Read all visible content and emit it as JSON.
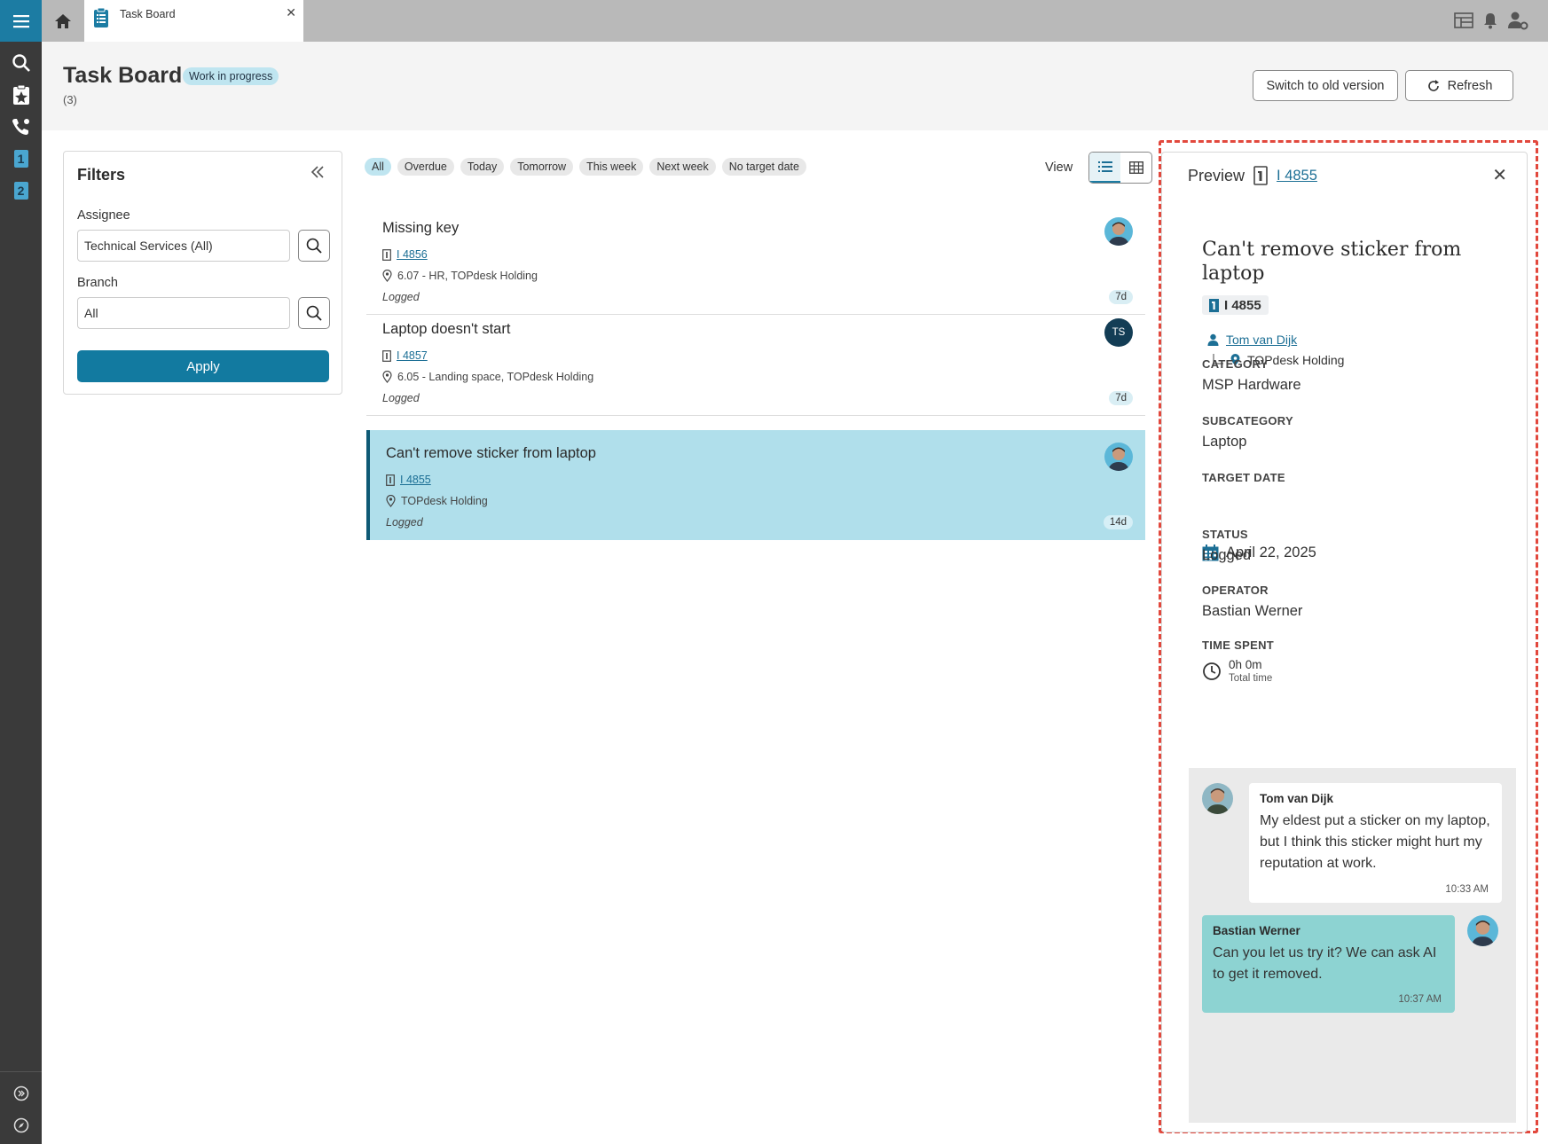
{
  "tab": {
    "label": "Task Board"
  },
  "header": {
    "title": "Task Board",
    "badge": "Work in progress",
    "count": "(3)",
    "switch_label": "Switch to old version",
    "refresh_label": "Refresh"
  },
  "filters": {
    "title": "Filters",
    "assignee_label": "Assignee",
    "assignee_value": "Technical Services (All)",
    "branch_label": "Branch",
    "branch_value": "All",
    "apply_label": "Apply"
  },
  "chips": [
    "All",
    "Overdue",
    "Today",
    "Tomorrow",
    "This week",
    "Next week",
    "No target date"
  ],
  "view_label": "View",
  "tasks": [
    {
      "title": "Missing key",
      "id": "I 4856",
      "location": "6.07 - HR, TOPdesk Holding",
      "status": "Logged",
      "age": "7d"
    },
    {
      "title": "Laptop doesn't start",
      "id": "I 4857",
      "location": "6.05 - Landing space, TOPdesk Holding",
      "status": "Logged",
      "age": "7d",
      "avatar_initials": "TS"
    },
    {
      "title": "Can't remove sticker from laptop",
      "id": "I 4855",
      "location": "TOPdesk Holding",
      "status": "Logged",
      "age": "14d"
    }
  ],
  "preview": {
    "label": "Preview",
    "id": "I 4855",
    "title": "Can't remove sticker from laptop",
    "badge_id": "I 4855",
    "person": "Tom van Dijk",
    "branch": "TOPdesk Holding",
    "category_label": "CATEGORY",
    "category": "MSP Hardware",
    "subcategory_label": "SUBCATEGORY",
    "subcategory": "Laptop",
    "target_date_label": "TARGET DATE",
    "target_date": "April 22, 2025",
    "status_label": "STATUS",
    "status": "Logged",
    "operator_label": "OPERATOR",
    "operator": "Bastian Werner",
    "time_spent_label": "TIME SPENT",
    "time_spent": "0h 0m",
    "time_spent_sub": "Total time"
  },
  "chat": [
    {
      "name": "Tom van Dijk",
      "text": "My eldest put a sticker on my laptop, but I think this sticker might hurt my reputation at work.",
      "time": "10:33 AM"
    },
    {
      "name": "Bastian Werner",
      "text": "Can you let us try it? We can ask AI to get it removed.",
      "time": "10:37 AM"
    }
  ],
  "colors": {
    "accent": "#127aa0",
    "selected_row": "#b0dfeb",
    "rail": "#3a3a3a",
    "highlight_outline": "#e2483d"
  }
}
